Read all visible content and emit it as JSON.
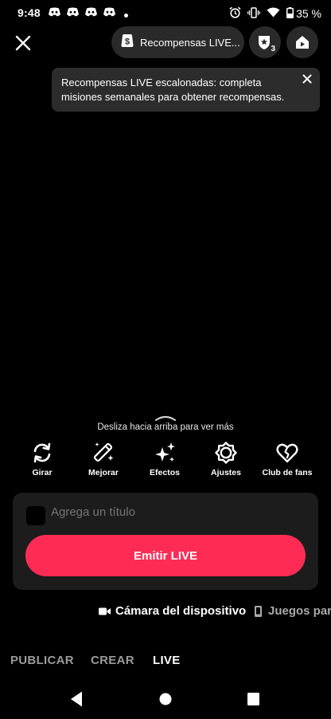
{
  "status_bar": {
    "time": "9:48",
    "battery": "35 %",
    "icons": [
      "discord-icon",
      "discord-icon",
      "discord-icon",
      "discord-icon",
      "dot-icon",
      "alarm-icon",
      "vibrate-icon",
      "wifi-icon",
      "battery-icon"
    ]
  },
  "top_bar": {
    "rewards_label": "Recompensas LIVE...",
    "badge_count": "3"
  },
  "tooltip": {
    "text": "Recompensas LIVE escalonadas: completa misiones semanales para obtener recompensas."
  },
  "swipe_hint": "Desliza hacia arriba para ver más",
  "tools": [
    {
      "label": "Girar",
      "icon": "rotate-icon"
    },
    {
      "label": "Mejorar",
      "icon": "magic-wand-icon"
    },
    {
      "label": "Efectos",
      "icon": "sparkles-icon"
    },
    {
      "label": "Ajustes",
      "icon": "adjust-icon"
    },
    {
      "label": "Club de fans",
      "icon": "heart-icon"
    }
  ],
  "panel": {
    "title_placeholder": "Agrega un título",
    "emit_label": "Emitir LIVE"
  },
  "sources": {
    "camera": "Cámara del dispositivo",
    "games": "Juegos par"
  },
  "mode_tabs": [
    "PUBLICAR",
    "CREAR",
    "LIVE"
  ],
  "colors": {
    "accent": "#fe2c55",
    "background": "#000000",
    "panel": "#1c1c1c"
  }
}
